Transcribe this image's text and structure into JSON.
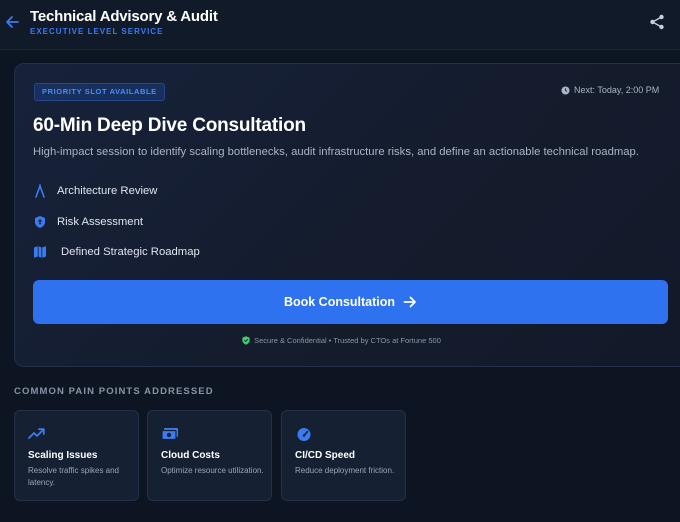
{
  "header": {
    "title": "Technical Advisory & Audit",
    "subtitle": "EXECUTIVE LEVEL SERVICE",
    "back_icon": "arrow-left-icon",
    "share_icon": "share-icon"
  },
  "card": {
    "badge": "PRIORITY SLOT AVAILABLE",
    "next_slot": "Next: Today, 2:00 PM",
    "title": "60-Min Deep Dive Consultation",
    "description": "High-impact session to identify scaling bottlenecks, audit infrastructure risks, and define an actionable technical roadmap.",
    "features": [
      {
        "label": "Architecture Review",
        "icon": "architecture-icon"
      },
      {
        "label": "Risk Assessment",
        "icon": "shield-icon"
      },
      {
        "label": "Defined Strategic Roadmap",
        "icon": "map-icon"
      }
    ],
    "cta_label": "Book Consultation",
    "trust_text": "Secure & Confidential • Trusted by CTOs at Fortune 500"
  },
  "pain_points": {
    "section_title": "COMMON PAIN POINTS ADDRESSED",
    "items": [
      {
        "title": "Scaling Issues",
        "description": "Resolve traffic spikes and latency.",
        "icon": "trending-up-icon"
      },
      {
        "title": "Cloud Costs",
        "description": "Optimize resource utilization.",
        "icon": "money-icon"
      },
      {
        "title": "CI/CD Speed",
        "description": "Reduce deployment friction.",
        "icon": "speedometer-icon"
      }
    ]
  },
  "colors": {
    "accent": "#2f72f0",
    "background": "#0e1522",
    "success": "#3ecf6c"
  }
}
